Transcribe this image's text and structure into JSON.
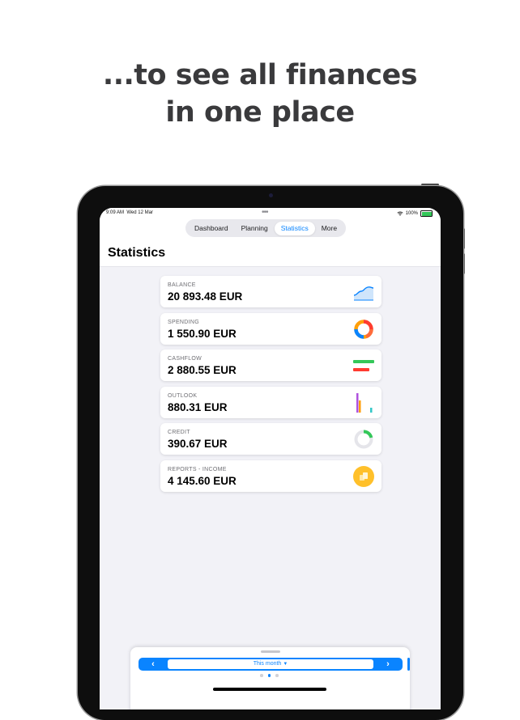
{
  "headline": {
    "line1": "...to see all finances",
    "line2": "in one place"
  },
  "status_bar": {
    "time": "9:09 AM",
    "date": "Wed 12 Mar",
    "battery": "100%"
  },
  "tabs": [
    {
      "label": "Dashboard",
      "active": false
    },
    {
      "label": "Planning",
      "active": false
    },
    {
      "label": "Statistics",
      "active": true
    },
    {
      "label": "More",
      "active": false
    }
  ],
  "page": {
    "title": "Statistics"
  },
  "cards": [
    {
      "label": "BALANCE",
      "value": "20 893.48 EUR",
      "icon": "area-chart-icon"
    },
    {
      "label": "SPENDING",
      "value": "1 550.90 EUR",
      "icon": "donut-chart-icon"
    },
    {
      "label": "CASHFLOW",
      "value": "2 880.55 EUR",
      "icon": "cashflow-bars-icon"
    },
    {
      "label": "OUTLOOK",
      "value": "880.31 EUR",
      "icon": "bar-chart-icon"
    },
    {
      "label": "CREDIT",
      "value": "390.67 EUR",
      "icon": "progress-ring-icon"
    },
    {
      "label": "REPORTS - INCOME",
      "value": "4 145.60 EUR",
      "icon": "reports-coin-icon"
    }
  ],
  "period_selector": {
    "prev": "‹",
    "next": "›",
    "label": "This month",
    "caret": "▼"
  },
  "colors": {
    "accent": "#0a84ff",
    "background": "#f2f2f7",
    "battery": "#34c759"
  }
}
